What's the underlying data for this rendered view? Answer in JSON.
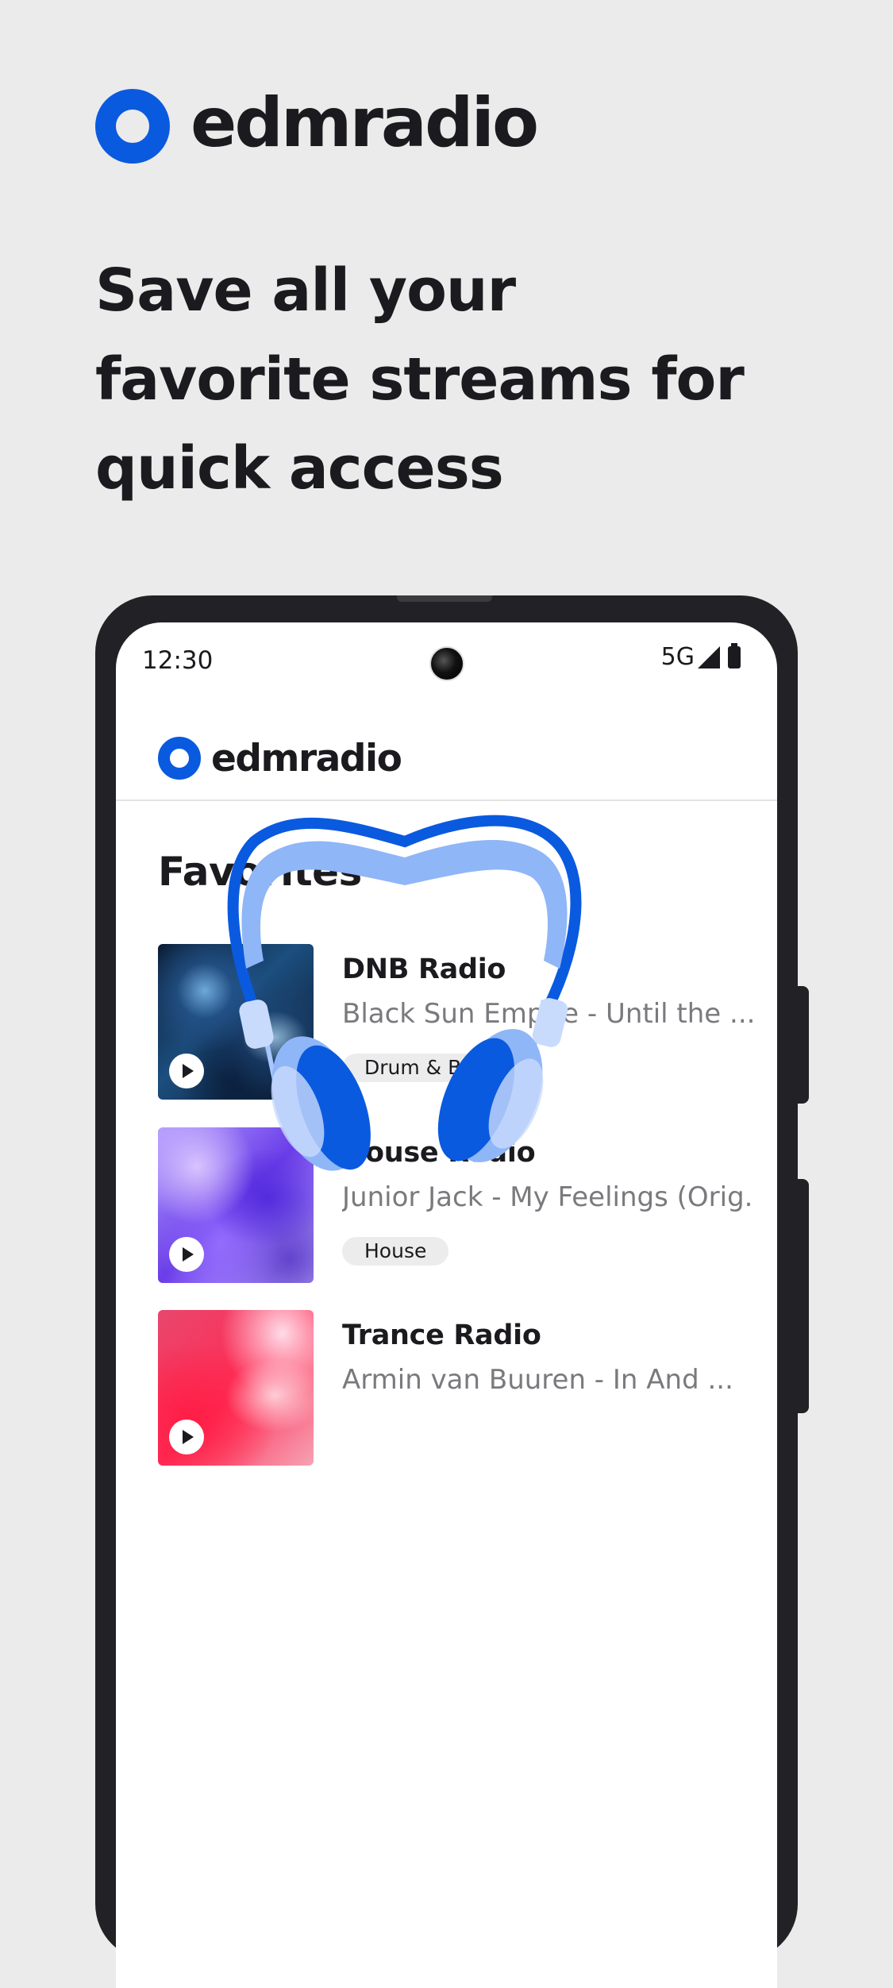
{
  "brand": {
    "name": "edmradio",
    "accent_color": "#0a5ae0"
  },
  "headline": {
    "lines": [
      "Save all your",
      "favorite streams for",
      "quick access"
    ]
  },
  "phone": {
    "status_bar": {
      "time": "12:30",
      "network": "5G"
    },
    "app_bar": {
      "name": "edmradio"
    },
    "section_title": "Favorites",
    "stations": [
      {
        "title": "DNB Radio",
        "track": "Black Sun Empire - Until the ...",
        "genre": "Drum & Bass",
        "icon": "play-icon"
      },
      {
        "title": "House Radio",
        "track": "Junior Jack - My Feelings (Orig...",
        "genre": "House",
        "icon": "play-icon"
      },
      {
        "title": "Trance Radio",
        "track": "Armin van Buuren - In And ...",
        "icon": "play-icon"
      }
    ],
    "illustration": "headphones-icon"
  }
}
